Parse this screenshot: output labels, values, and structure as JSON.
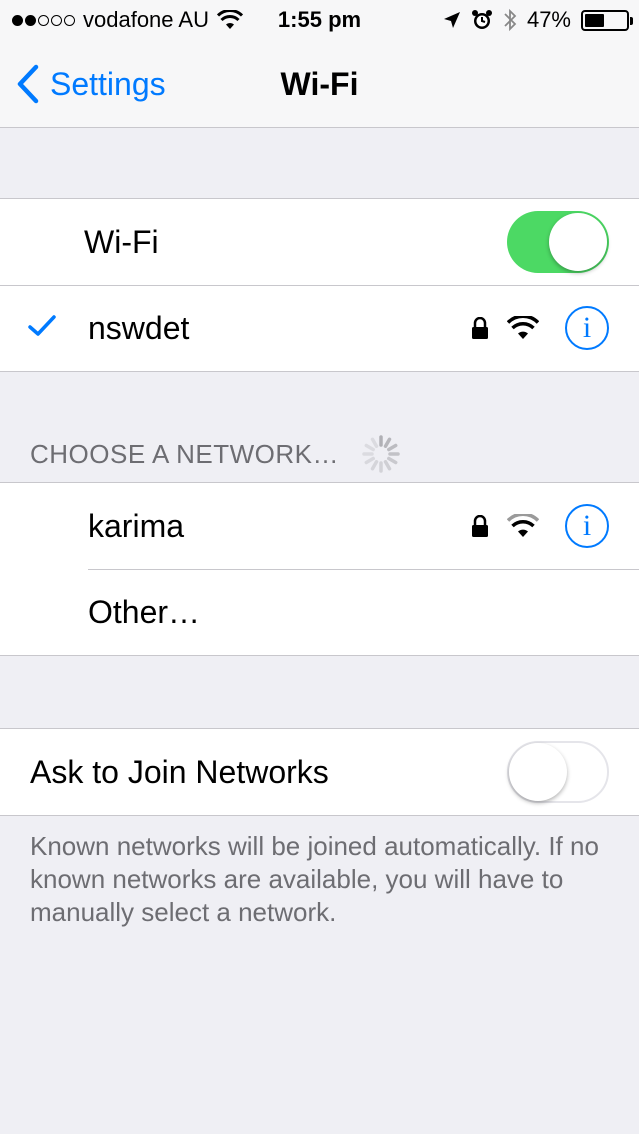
{
  "status_bar": {
    "carrier": "vodafone AU",
    "time": "1:55 pm",
    "battery": "47%",
    "battery_level": 0.47,
    "signal_bars": 2
  },
  "nav": {
    "back_label": "Settings",
    "title": "Wi-Fi"
  },
  "wifi": {
    "label": "Wi-Fi",
    "enabled": true
  },
  "connected": {
    "name": "nswdet"
  },
  "choose": {
    "header": "CHOOSE A NETWORK…",
    "networks": [
      {
        "name": "karima"
      }
    ],
    "other_label": "Other…"
  },
  "ask_join": {
    "label": "Ask to Join Networks",
    "enabled": false,
    "footer": "Known networks will be joined automatically. If no known networks are available, you will have to manually select a network."
  },
  "colors": {
    "accent": "#007aff",
    "toggle_on": "#4cd964",
    "background": "#efeff4"
  }
}
